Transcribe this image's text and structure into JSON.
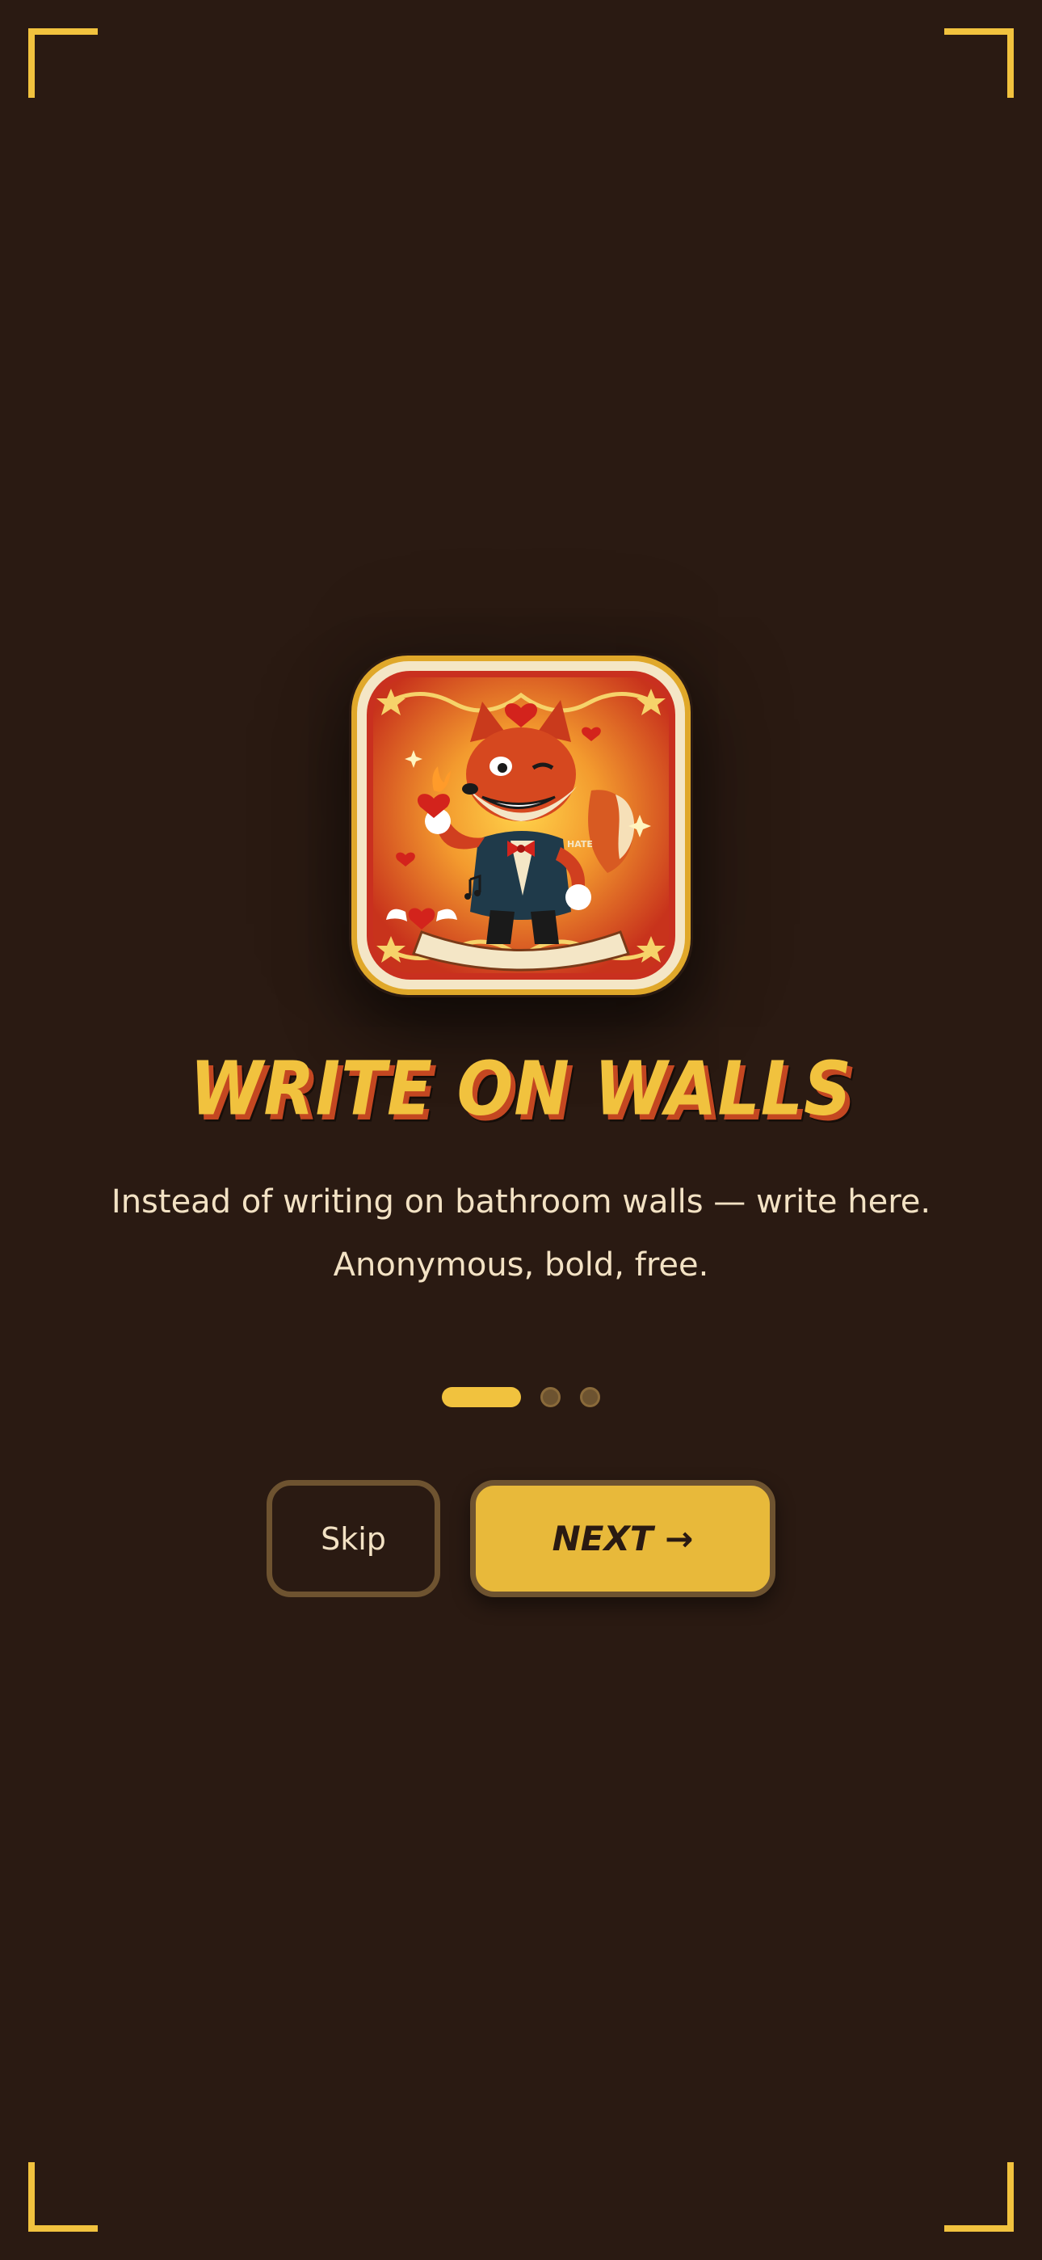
{
  "onboarding": {
    "title": "WRITE ON WALLS",
    "subtitle_line1": "Instead of writing on bathroom walls — write here.",
    "subtitle_line2": "Anonymous, bold, free.",
    "page_indicator": {
      "current": 1,
      "total": 3
    },
    "buttons": {
      "skip_label": "Skip",
      "next_label": "NEXT →"
    },
    "badge": {
      "tattoo_text": "HATE"
    }
  },
  "colors": {
    "background": "#2a1a12",
    "accent": "#f1c23e",
    "title_shadow": "#c44721",
    "text": "#f3e2c4",
    "button_border": "#6e5330"
  }
}
